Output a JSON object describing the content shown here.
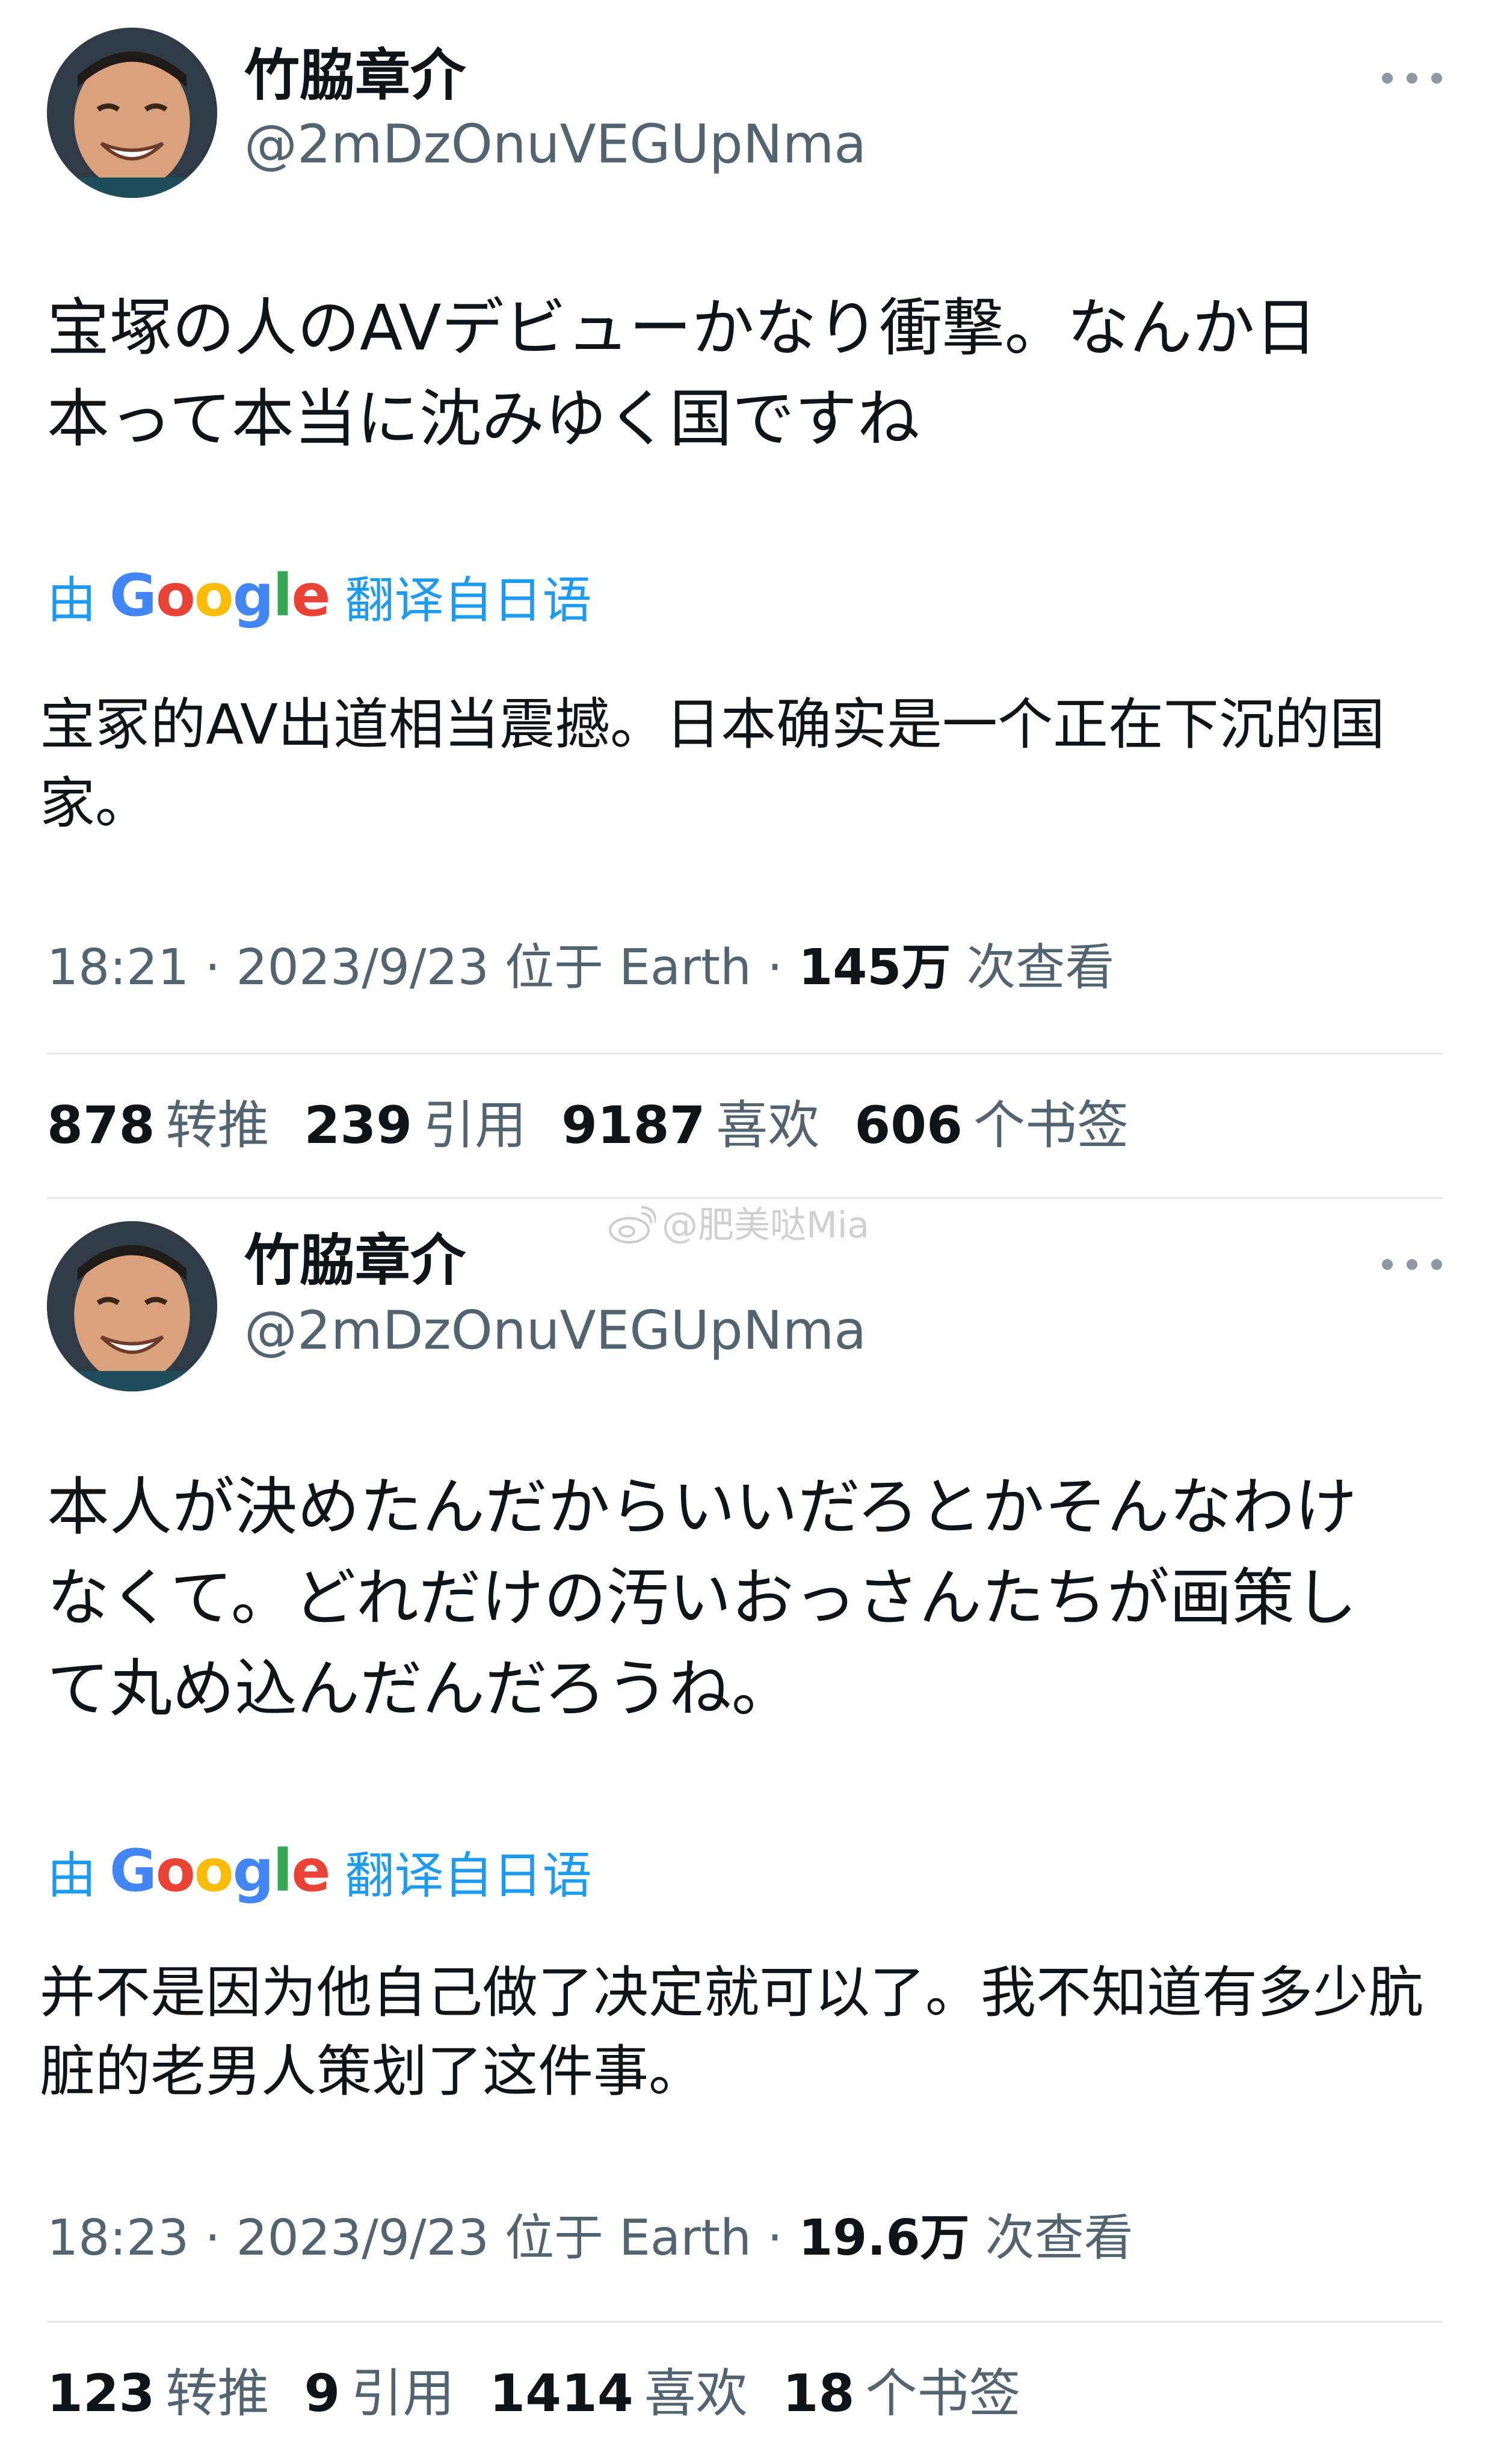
{
  "watermark": "@肥美哒Mia",
  "tweets": [
    {
      "display_name": "竹脇章介",
      "handle": "@2mDzOnuVEGUpNma",
      "text": "宝塚の人のAVデビューかなり衝撃。なんか日\n本って本当に沈みゆく国ですね",
      "translate_by": "由",
      "translate_from": "翻译自日语",
      "translation": "宝冢的AV出道相当震撼。日本确实是一个正在下沉的国家。",
      "time_date": "18:21 · 2023/9/23 位于 Earth · ",
      "views_num": "145万",
      "views_label": " 次查看",
      "stats": [
        {
          "num": "878",
          "label": "转推"
        },
        {
          "num": "239",
          "label": "引用"
        },
        {
          "num": "9187",
          "label": "喜欢"
        },
        {
          "num": "606",
          "label": "个书签"
        }
      ]
    },
    {
      "display_name": "竹脇章介",
      "handle": "@2mDzOnuVEGUpNma",
      "text": "本人が決めたんだからいいだろとかそんなわけ\nなくて。どれだけの汚いおっさんたちが画策し\nて丸め込んだんだろうね。",
      "translate_by": "由",
      "translate_from": "翻译自日语",
      "translation": "并不是因为他自己做了决定就可以了。我不知道有多少肮脏的老男人策划了这件事。",
      "time_date": "18:23 · 2023/9/23 位于 Earth · ",
      "views_num": "19.6万",
      "views_label": " 次查看",
      "stats": [
        {
          "num": "123",
          "label": "转推"
        },
        {
          "num": "9",
          "label": "引用"
        },
        {
          "num": "1414",
          "label": "喜欢"
        },
        {
          "num": "18",
          "label": "个书签"
        }
      ]
    }
  ],
  "google_logo": "Google",
  "icons": {
    "avatar": "profile-photo",
    "more": "more-options-icon",
    "weibo": "weibo-logo-icon"
  },
  "colors": {
    "link_blue": "#1d9bf0",
    "secondary_text": "#536471",
    "primary_text": "#0f1419",
    "divider": "#e6e9ec"
  }
}
